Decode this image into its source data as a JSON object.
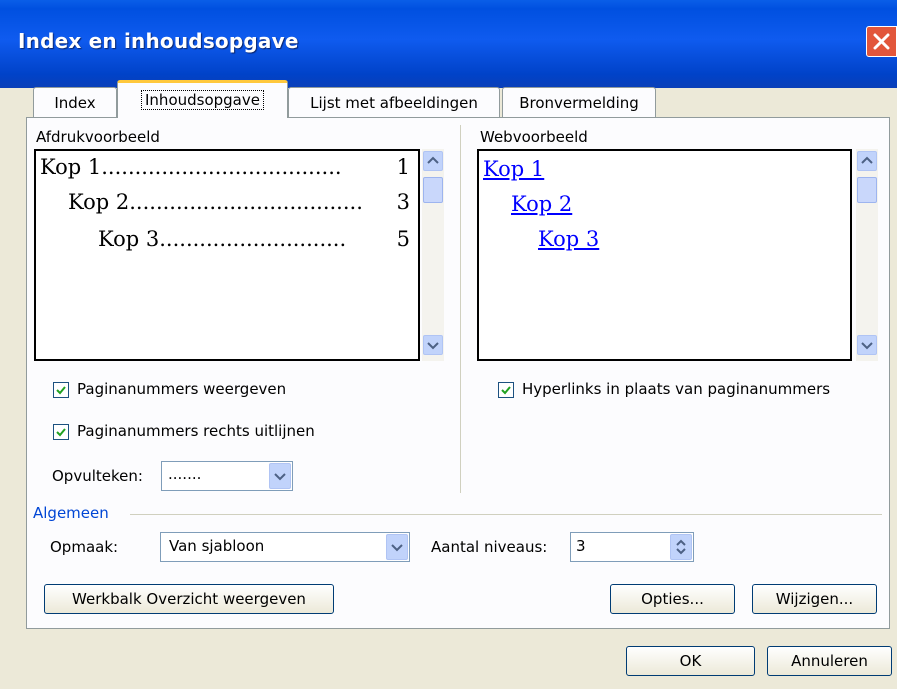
{
  "window": {
    "title": "Index en inhoudsopgave"
  },
  "tabs": [
    {
      "label": "Index"
    },
    {
      "label": "Inhoudsopgave"
    },
    {
      "label": "Lijst met afbeeldingen"
    },
    {
      "label": "Bronvermelding"
    }
  ],
  "print_preview": {
    "label": "Afdrukvoorbeeld",
    "entries": [
      {
        "text": "Kop 1",
        "dots": "....................................",
        "page": "1"
      },
      {
        "text": "Kop 2",
        "dots": "...................................",
        "page": "3"
      },
      {
        "text": "Kop 3",
        "dots": "............................",
        "page": "5"
      }
    ]
  },
  "web_preview": {
    "label": "Webvoorbeeld",
    "links": [
      "Kop 1",
      "Kop 2",
      "Kop 3"
    ]
  },
  "options": {
    "show_page_numbers": {
      "label": "Paginanummers weergeven",
      "checked": true
    },
    "right_align_page_numbers": {
      "label": "Paginanummers rechts uitlijnen",
      "checked": true
    },
    "hyperlinks": {
      "label": "Hyperlinks in plaats van paginanummers",
      "checked": true
    },
    "tab_leader": {
      "label": "Opvulteken:",
      "value": "......."
    }
  },
  "general": {
    "label": "Algemeen",
    "format_label": "Opmaak:",
    "format_value": "Van sjabloon",
    "levels_label": "Aantal niveaus:",
    "levels_value": "3"
  },
  "buttons": {
    "outline_toolbar": "Werkbalk Overzicht weergeven",
    "options": "Opties...",
    "modify": "Wijzigen...",
    "ok": "OK",
    "cancel": "Annuleren"
  },
  "colors": {
    "titlebar": "#0050e0",
    "accent": "#0046d5",
    "link": "#0000ff"
  }
}
